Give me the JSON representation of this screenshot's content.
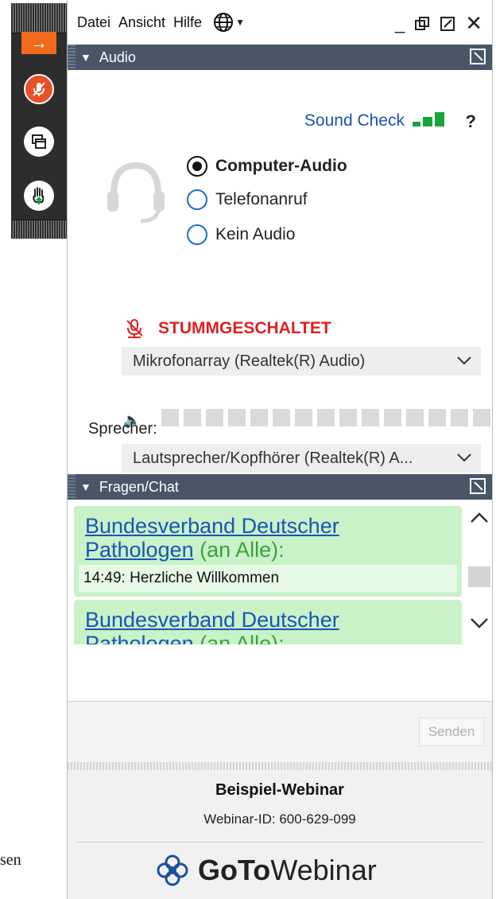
{
  "menu": {
    "items": [
      "Datei",
      "Ansicht",
      "Hilfe"
    ]
  },
  "audio": {
    "title": "Audio",
    "sound_check": "Sound Check",
    "help": "?",
    "options": [
      {
        "label": "Computer-Audio",
        "selected": true
      },
      {
        "label": "Telefonanruf",
        "selected": false
      },
      {
        "label": "Kein Audio",
        "selected": false
      }
    ],
    "muted_label": "STUMMGESCHALTET",
    "microphone": "Mikrofonarray (Realtek(R) Audio)",
    "speaker": "Lautsprecher/Kopfhörer  (Realtek(R) A...",
    "speaker_label": "Sprecher:"
  },
  "chat": {
    "title": "Fragen/Chat",
    "messages": [
      {
        "sender_line1": "Bundesverband Deutscher",
        "sender_line2": "Pathologen",
        "recipient": " (an Alle):",
        "text": "14:49: Herzliche Willkommen"
      },
      {
        "sender_line1": "Bundesverband Deutscher",
        "sender_line2": "Pathologen",
        "recipient": " (an Alle):"
      }
    ],
    "send_label": "Senden"
  },
  "footer": {
    "webinar_title": "Beispiel-Webinar",
    "webinar_id": "Webinar-ID: 600-629-099",
    "logo_bold": "GoTo",
    "logo_light": "Webinar"
  },
  "background": {
    "stray_text": "sen"
  },
  "colors": {
    "accent_orange": "#f26a1b",
    "header_slate": "#4a5568",
    "link_blue": "#1b55b5",
    "muted_red": "#e02020",
    "chat_green": "#c9f2c9",
    "signal_green": "#17a43a"
  }
}
